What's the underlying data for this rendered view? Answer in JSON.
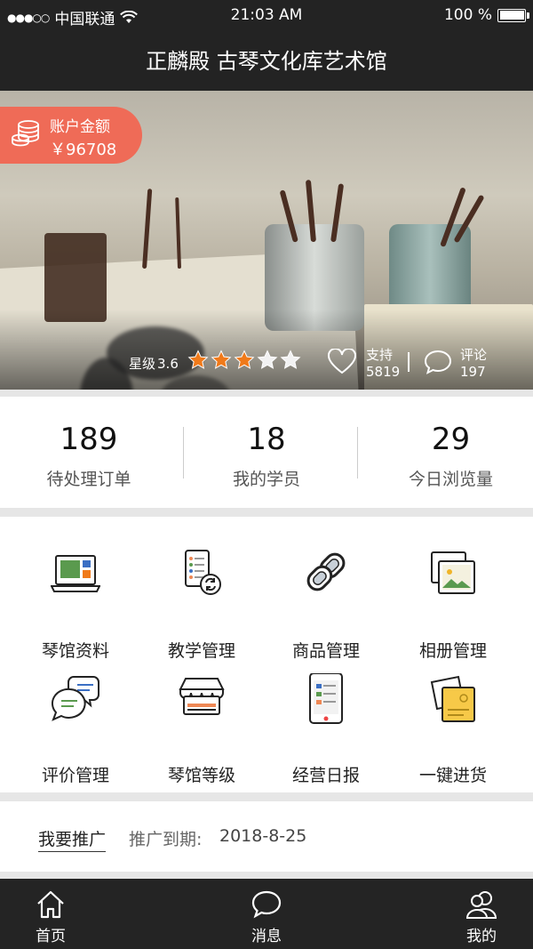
{
  "status_bar": {
    "signal": "●●●○○",
    "carrier": "中国联通",
    "time": "21:03 AM",
    "battery": "100 %"
  },
  "header": {
    "title": "正麟殿 古琴文化库艺术馆"
  },
  "balance": {
    "label": "账户金额",
    "amount": "￥96708",
    "icon": "coins-icon"
  },
  "rating": {
    "label": "星级",
    "value": "3.6",
    "stars_filled": 3,
    "stars_total": 5,
    "star_color": "#f07a1a"
  },
  "support": {
    "label": "支持",
    "count": "5819"
  },
  "comments": {
    "label": "评论",
    "count": "197"
  },
  "stats": [
    {
      "value": "189",
      "label": "待处理订单"
    },
    {
      "value": "18",
      "label": "我的学员"
    },
    {
      "value": "29",
      "label": "今日浏览量"
    }
  ],
  "menu": [
    {
      "label": "琴馆资料",
      "icon": "laptop-icon"
    },
    {
      "label": "教学管理",
      "icon": "schedule-icon"
    },
    {
      "label": "商品管理",
      "icon": "chain-link-icon"
    },
    {
      "label": "相册管理",
      "icon": "photo-album-icon"
    },
    {
      "label": "评价管理",
      "icon": "chat-bubbles-icon"
    },
    {
      "label": "琴馆等级",
      "icon": "storefront-icon"
    },
    {
      "label": "经营日报",
      "icon": "phone-report-icon"
    },
    {
      "label": "一键进货",
      "icon": "sticky-notes-icon"
    }
  ],
  "promotion": {
    "link": "我要推广",
    "expiry_label": "推广到期:",
    "expiry_date": "2018-8-25"
  },
  "tabs": [
    {
      "label": "首页",
      "icon": "home-icon"
    },
    {
      "label": "消息",
      "icon": "message-icon"
    },
    {
      "label": "我的",
      "icon": "user-icon"
    }
  ],
  "colors": {
    "dark_bar": "#232323",
    "accent": "#ef6b57",
    "star": "#f07a1a"
  }
}
